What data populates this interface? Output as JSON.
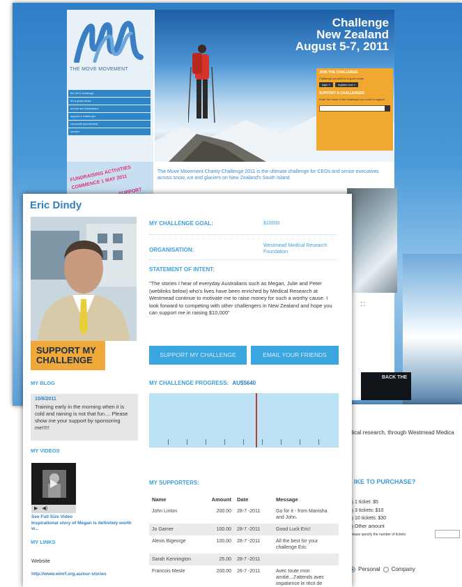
{
  "back_page": {
    "logo": {
      "brand": "THE MOVE MOVEMENT",
      "tagline": ""
    },
    "nav_items": [
      "the 2011 challenge",
      "it's a good cause",
      "events and fundraisers",
      "support a challenger",
      "corporate sponsorship",
      "contact"
    ],
    "promo_text": [
      "FUNDRAISING ACTIVITIES",
      "COMMENCE 1 MAY 2011",
      "SUPPORT"
    ],
    "hero": {
      "line1": "Challenge",
      "line2": "New Zealand",
      "line3": "August 5-7, 2011"
    },
    "join_box": {
      "title": "JOIN THE CHALLENGE",
      "text": "Challenge yourself for a good cause",
      "login": "login »",
      "register": "register now »",
      "support_title": "SUPPORT A CHALLENGER",
      "support_text": "Enter the name of the challenger you want to support"
    },
    "intro": "The Move Movement Charity Challenge 2011 is the ultimate challenge for CEOs and senior executives across snow, ice and glaciers on New Zealand's South Island",
    "side_caption": "",
    "bottom_banner": "BACK THE"
  },
  "ticket_page": {
    "intro": "dical research, through Westmead Medica",
    "heading": "IKE TO PURCHASE?",
    "options": [
      "1 ticket: $5",
      "3 tickets: $10",
      "10 tickets: $30",
      "Other amount"
    ],
    "specify": "Please specify the number of tickets",
    "type_options": [
      "Personal",
      "Company"
    ],
    "type_selected": "Personal"
  },
  "profile": {
    "name": "Eric Dindy",
    "support_button": "SUPPORT MY CHALLENGE",
    "goal_label": "MY CHALLENGE GOAL:",
    "goal_value": "$10000",
    "org_label": "ORGANISATION:",
    "org_value": "Westmead Medical Research Foundation",
    "intent_label": "STATEMENT OF INTENT:",
    "intent_text": "\"The stories I hear of everyday Australians such as Megan, Julie and Peter (weblinks below) who's lives have been enriched by Medical Research at Westmead continue to motivate me to raise money for such a worthy cause. I look forward to competing with other challengers in New Zealand and hope you can support me in raising $10,000\"",
    "btn_support": "SUPPORT MY CHALLENGE",
    "btn_email": "EMAIL YOUR FRIENDS",
    "progress_label": "MY CHALLENGE PROGRESS:",
    "progress_amount": "AU$5640",
    "progress_fraction": 0.564,
    "blog_label": "MY BLOG",
    "blog_date": "15/6/2011",
    "blog_text": "Training early in the morning when it is cold and raining is not that fun.... Please show me your support by sponsoring me!!!!!",
    "videos_label": "MY VIDEOS",
    "video_link": "See Full Size Video",
    "video_caption": "Inspirational story of Megan is definitely worth w...",
    "links_label": "MY LINKS",
    "website_label": "Website",
    "website_url": "http://www.wmrf.org.au/our-stories",
    "supporters_label": "MY SUPPORTERS:",
    "supporters_headers": [
      "Name",
      "Amount",
      "Date",
      "Message"
    ],
    "supporters": [
      {
        "name": "John Linton",
        "amount": "200.00",
        "date": "28-7 -2011",
        "message": "Go for it - from Manisha and John."
      },
      {
        "name": "Jo Garner",
        "amount": "100.00",
        "date": "28-7 -2011",
        "message": "Good Luck Eric!"
      },
      {
        "name": "Alexis Bigeorge",
        "amount": "100.00",
        "date": "28-7 -2011",
        "message": "All the best for your challenge Eric"
      },
      {
        "name": "Sarah Kennington",
        "amount": "25.00",
        "date": "28-7 -2011",
        "message": ""
      },
      {
        "name": "Francois Mesle",
        "amount": "200.00",
        "date": "26-7 -2011",
        "message": "Avec toute mon amitié...J'attends avec impatience le récit de"
      }
    ]
  },
  "colors": {
    "accent_blue": "#3aa6e0",
    "accent_orange": "#f0a838",
    "title_blue": "#2f7fc2"
  }
}
